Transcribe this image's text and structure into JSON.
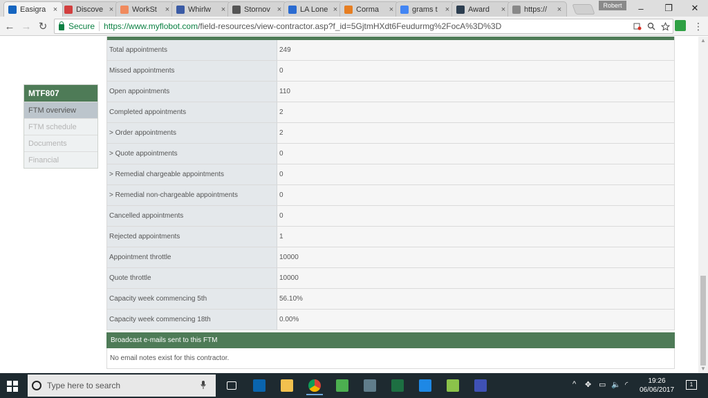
{
  "browser": {
    "tabs": [
      {
        "label": "Easigra",
        "icon": "easigrant-icon",
        "color": "#1565c0",
        "active": true
      },
      {
        "label": "Discove",
        "icon": "discover-icon",
        "color": "#d23f3f",
        "active": false
      },
      {
        "label": "WorkSt",
        "icon": "workstation-icon",
        "color": "#f08a5d",
        "active": false
      },
      {
        "label": "Whirlw",
        "icon": "whirlwind-icon",
        "color": "#3b5ba5",
        "active": false
      },
      {
        "label": "Stornov",
        "icon": "stornoway-icon",
        "color": "#555555",
        "active": false
      },
      {
        "label": "LA Lone",
        "icon": "la-icon",
        "color": "#2a6bd1",
        "active": false
      },
      {
        "label": "Corma",
        "icon": "cormac-icon",
        "color": "#e67e22",
        "active": false
      },
      {
        "label": "grams t",
        "icon": "google-icon",
        "color": "#4285f4",
        "active": false
      },
      {
        "label": "Award",
        "icon": "award-icon",
        "color": "#2c3e50",
        "active": false
      },
      {
        "label": "https://",
        "icon": "page-icon",
        "color": "#888888",
        "active": false
      }
    ],
    "close_glyph": "×",
    "profile_name": "Robert",
    "window_controls": {
      "minimize": "–",
      "maximize": "❐",
      "close": "✕"
    },
    "secure_label": "Secure",
    "url_host": "https://www.myflobot.com",
    "url_path": "/field-resources/view-contractor.asp?f_id=5GjtmHXdt6Feudurmg%2FocA%3D%3D",
    "nav": {
      "back": "←",
      "forward": "→",
      "reload": "↻"
    },
    "menu_glyph": "⋮"
  },
  "sidenav": {
    "title": "MTF807",
    "items": [
      {
        "label": "FTM overview",
        "active": true
      },
      {
        "label": "FTM schedule",
        "active": false
      },
      {
        "label": "Documents",
        "active": false
      },
      {
        "label": "Financial",
        "active": false
      }
    ]
  },
  "stats": {
    "rows": [
      {
        "label": "Total appointments",
        "value": "249"
      },
      {
        "label": "Missed appointments",
        "value": "0"
      },
      {
        "label": "Open appointments",
        "value": "110"
      },
      {
        "label": "Completed appointments",
        "value": "2"
      },
      {
        "label": "> Order appointments",
        "value": "2"
      },
      {
        "label": "> Quote appointments",
        "value": "0"
      },
      {
        "label": "> Remedial chargeable appointments",
        "value": "0"
      },
      {
        "label": "> Remedial non-chargeable appointments",
        "value": "0"
      },
      {
        "label": "Cancelled appointments",
        "value": "0"
      },
      {
        "label": "Rejected appointments",
        "value": "1"
      },
      {
        "label": "Appointment throttle",
        "value": "10000"
      },
      {
        "label": "Quote throttle",
        "value": "10000"
      },
      {
        "label": "Capacity week commencing 5th",
        "value": "56.10%"
      },
      {
        "label": "Capacity week commencing 18th",
        "value": "0.00%"
      }
    ]
  },
  "broadcast": {
    "title": "Broadcast e-mails sent to this FTM",
    "empty_note": "No email notes exist for this contractor."
  },
  "taskbar": {
    "search_placeholder": "Type here to search",
    "apps": [
      {
        "name": "task-view-icon",
        "color": "#1e2a30"
      },
      {
        "name": "outlook-icon",
        "color": "#0a64ad"
      },
      {
        "name": "file-explorer-icon",
        "color": "#f2c14e"
      },
      {
        "name": "chrome-icon",
        "color": "#db4437"
      },
      {
        "name": "app-icon",
        "color": "#4caf50"
      },
      {
        "name": "app2-icon",
        "color": "#607d8b"
      },
      {
        "name": "excel-icon",
        "color": "#1d6f42"
      },
      {
        "name": "edge-icon",
        "color": "#1e88e5"
      },
      {
        "name": "app3-icon",
        "color": "#8bc34a"
      },
      {
        "name": "app4-icon",
        "color": "#3f51b5"
      }
    ],
    "time": "19:26",
    "date": "06/06/2017"
  }
}
